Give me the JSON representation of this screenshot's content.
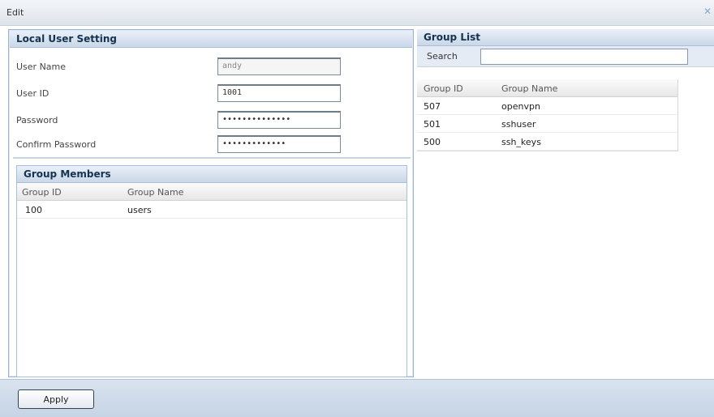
{
  "window": {
    "title": "Edit",
    "close_glyph": "✕"
  },
  "local_user": {
    "header": "Local User Setting",
    "fields": [
      {
        "label": "User Name",
        "value": "andy",
        "readonly": true
      },
      {
        "label": "User ID",
        "value": "1001"
      },
      {
        "label": "Password",
        "value": "••••••••••••••"
      },
      {
        "label": "Confirm Password",
        "value": "•••••••••••••"
      }
    ]
  },
  "group_members": {
    "header": "Group Members",
    "columns": [
      "Group ID",
      "Group Name"
    ],
    "rows": [
      {
        "id": "100",
        "name": "users"
      }
    ]
  },
  "group_list": {
    "header": "Group List",
    "search_label": "Search",
    "search_value": "",
    "columns": [
      "Group ID",
      "Group Name"
    ],
    "rows": [
      {
        "id": "507",
        "name": "openvpn"
      },
      {
        "id": "501",
        "name": "sshuser"
      },
      {
        "id": "500",
        "name": "ssh_keys"
      }
    ]
  },
  "footer": {
    "apply_label": "Apply"
  }
}
